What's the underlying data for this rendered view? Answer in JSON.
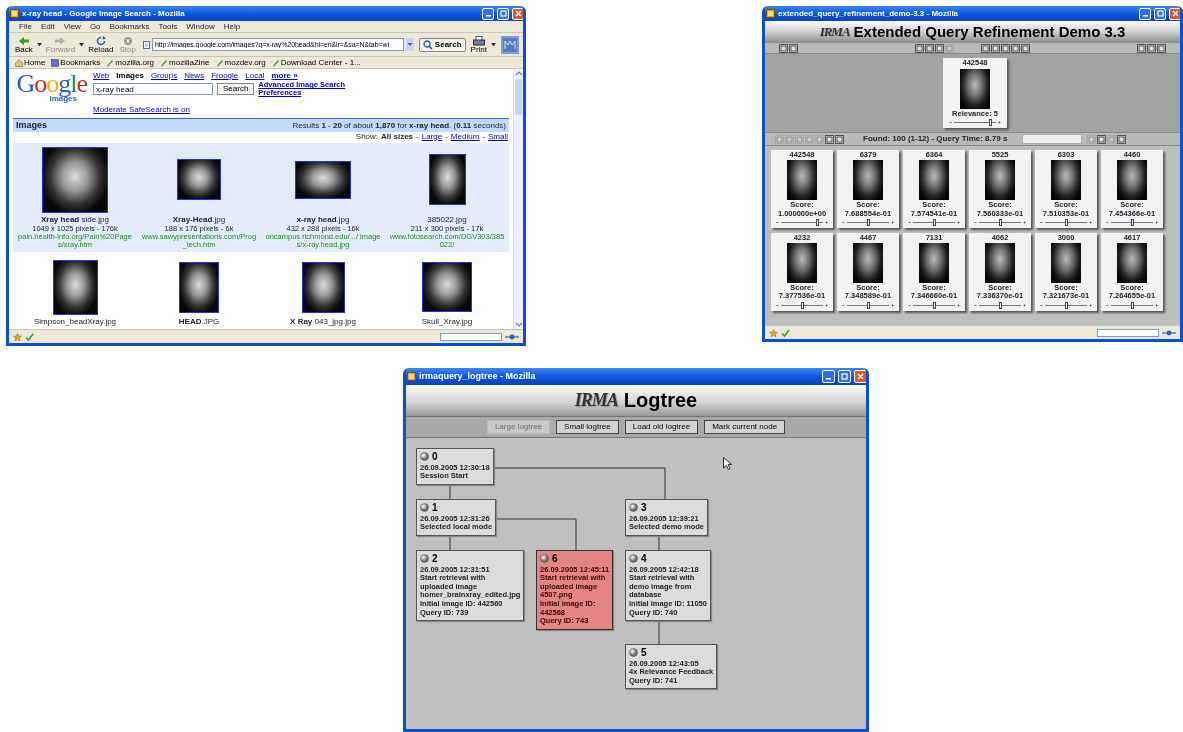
{
  "windows": [
    {
      "kind": "google",
      "title": "x-ray head - Google Image Search - Mozilla",
      "menu": [
        "File",
        "Edit",
        "View",
        "Go",
        "Bookmarks",
        "Tools",
        "Window",
        "Help"
      ],
      "nav_buttons": [
        {
          "label": "Back",
          "disabled": false
        },
        {
          "label": "Forward",
          "disabled": true
        },
        {
          "label": "Reload",
          "disabled": false
        },
        {
          "label": "Stop",
          "disabled": true
        }
      ],
      "url": "http://images.google.com/images?q=x-ray%20head&hl=en&lr=&sa=N&tab=wi",
      "search_button": "Search",
      "print_button": "Print",
      "bookmarks": [
        "Home",
        "Bookmarks",
        "mozilla.org",
        "mozillaZine",
        "mozdev.org",
        "Download Center - 1..."
      ],
      "logo": "Google",
      "logo_sub": "Images",
      "tabs": [
        {
          "label": "Web",
          "selected": false
        },
        {
          "label": "Images",
          "selected": true
        },
        {
          "label": "Groups",
          "selected": false
        },
        {
          "label": "News",
          "selected": false
        },
        {
          "label": "Froogle",
          "selected": false
        },
        {
          "label": "Local",
          "selected": false
        }
      ],
      "more_link": "more »",
      "query": "x-ray head",
      "query_button": "Search",
      "side_links": [
        "Advanced Image Search",
        "Preferences"
      ],
      "safesearch": "Moderate SafeSearch is on",
      "section_title": "Images",
      "results_summary": "Results **1** - **20** of about **1,870** for **x-ray head**. (**0.11** seconds)",
      "size_label": "Show:",
      "size_separator": "-",
      "sizes": [
        {
          "label": "All sizes",
          "selected": true
        },
        {
          "label": "Large",
          "selected": false
        },
        {
          "label": "Medium",
          "selected": false
        },
        {
          "label": "Small",
          "selected": false
        }
      ],
      "result_rows": [
        {
          "highlighted": true,
          "items": [
            {
              "name": "**Xray head** side.jpg",
              "info": "1049 x 1025 pixels - 176k",
              "site": "pain.health-info.org/Pain%20Pages/xray.htm"
            },
            {
              "name": "**Xray-Head**.jpg",
              "info": "188 x 176 pixels - 6k",
              "site": "www.sawypresentations.com/Prog_tech.htm"
            },
            {
              "name": "**x-ray head**.jpg",
              "info": "432 x 288 pixels - 16k",
              "site": "oncampus.richmond.edu/.../ images/x-ray.head.jpg"
            },
            {
              "name": "385022.jpg",
              "info": "211 x 300 pixels - 17k",
              "site": "www.fotosearch.com/DGV303/385022/"
            }
          ]
        },
        {
          "highlighted": false,
          "items": [
            {
              "name": "Simpson_headXray.jpg"
            },
            {
              "name": "**HEAD**.JPG"
            },
            {
              "name": "**X Ray** 043_jpg.jpg"
            },
            {
              "name": "Skull_Xray.jpg"
            }
          ]
        }
      ]
    },
    {
      "kind": "query_demo",
      "title": "extended_query_refinement_demo-3.3 - Mozilla",
      "logo": "IRMA",
      "heading": "Extended Query Refinement Demo 3.3",
      "toolbar_groups": [
        [
          {
            "disabled": false
          },
          {
            "disabled": false
          }
        ],
        [
          {
            "disabled": false
          },
          {
            "disabled": false
          },
          {
            "disabled": false
          },
          {
            "disabled": true
          }
        ],
        [
          {
            "disabled": false
          },
          {
            "disabled": false
          },
          {
            "disabled": false
          },
          {
            "disabled": false
          },
          {
            "disabled": false
          }
        ],
        [
          {
            "disabled": false
          },
          {
            "disabled": false
          },
          {
            "disabled": false
          }
        ]
      ],
      "query_image": {
        "id": "442548",
        "relevance": "Relevance: 5",
        "level": 0.85
      },
      "nav_left": [
        {
          "disabled": true
        },
        {
          "disabled": true
        },
        {
          "disabled": true
        },
        {
          "disabled": true
        },
        {
          "disabled": true
        },
        {
          "disabled": false
        },
        {
          "disabled": false
        }
      ],
      "status_text": "Found: 100 (1-12) - Query Time: 8.79 s",
      "nav_right": [
        {
          "disabled": true
        },
        {
          "disabled": false
        },
        {
          "disabled": true
        },
        {
          "disabled": false
        }
      ],
      "results": [
        {
          "id": "442548",
          "score": "Score: 1.000000e+00",
          "level": 0.85
        },
        {
          "id": "6379",
          "score": "Score: 7.688554e-01",
          "level": 0.5
        },
        {
          "id": "6364",
          "score": "Score: 7.574541e-01",
          "level": 0.5
        },
        {
          "id": "5525",
          "score": "Score: 7.560333e-01",
          "level": 0.5
        },
        {
          "id": "6303",
          "score": "Score: 7.510353e-01",
          "level": 0.5
        },
        {
          "id": "4460",
          "score": "Score: 7.454366e-01",
          "level": 0.5
        },
        {
          "id": "4232",
          "score": "Score: 7.377536e-01",
          "level": 0.5
        },
        {
          "id": "4467",
          "score": "Score: 7.348589e-01",
          "level": 0.5
        },
        {
          "id": "7131",
          "score": "Score: 7.346660e-01",
          "level": 0.5
        },
        {
          "id": "4062",
          "score": "Score: 7.336370e-01",
          "level": 0.5
        },
        {
          "id": "3000",
          "score": "Score: 7.321673e-01",
          "level": 0.5
        },
        {
          "id": "4617",
          "score": "Score: 7.264655e-01",
          "level": 0.5
        }
      ]
    },
    {
      "kind": "logtree",
      "title": "irmaquery_logtree - Mozilla",
      "logo": "IRMA",
      "heading": "Logtree",
      "buttons": [
        {
          "label": "Large logtree",
          "disabled": true
        },
        {
          "label": "Small logtree",
          "disabled": false
        },
        {
          "label": "Load old logtree",
          "disabled": false
        },
        {
          "label": "Mark current node",
          "disabled": false
        }
      ],
      "tree": {
        "number": "0",
        "timestamp": "26.09.2005 12:30:18",
        "details": [
          "Session Start"
        ],
        "selected": false,
        "children": [
          {
            "number": "1",
            "timestamp": "26.09.2005 12:31:26",
            "details": [
              "Selected local mode"
            ],
            "selected": false,
            "children": [
              {
                "number": "2",
                "timestamp": "26.09.2005 12:31:51",
                "details": [
                  "Start retrieval with",
                  "uploaded image",
                  "homer_brainxray_edited.jpg",
                  "Initial image ID: 442560",
                  "Query ID: 739"
                ],
                "selected": false
              },
              {
                "number": "6",
                "timestamp": "26.09.2005 12:45:11",
                "details": [
                  "Start retrieval with",
                  "uploaded image",
                  "4507.png",
                  "Initial image ID:",
                  "442568",
                  "Query ID: 743"
                ],
                "selected": true
              }
            ]
          },
          {
            "number": "3",
            "timestamp": "26.09.2005 12:39:21",
            "details": [
              "Selected demo mode"
            ],
            "selected": false,
            "children": [
              {
                "number": "4",
                "timestamp": "26.09.2005 12:42:18",
                "details": [
                  "Start retrieval with",
                  "demo image from",
                  "database",
                  "Initial image ID: 11050",
                  "Query ID: 740"
                ],
                "selected": false,
                "children": [
                  {
                    "number": "5",
                    "timestamp": "26.09.2005 12:43:05",
                    "details": [
                      "4x Relevance Feedback",
                      "Query ID: 741"
                    ],
                    "selected": false
                  }
                ]
              }
            ]
          }
        ]
      }
    }
  ]
}
